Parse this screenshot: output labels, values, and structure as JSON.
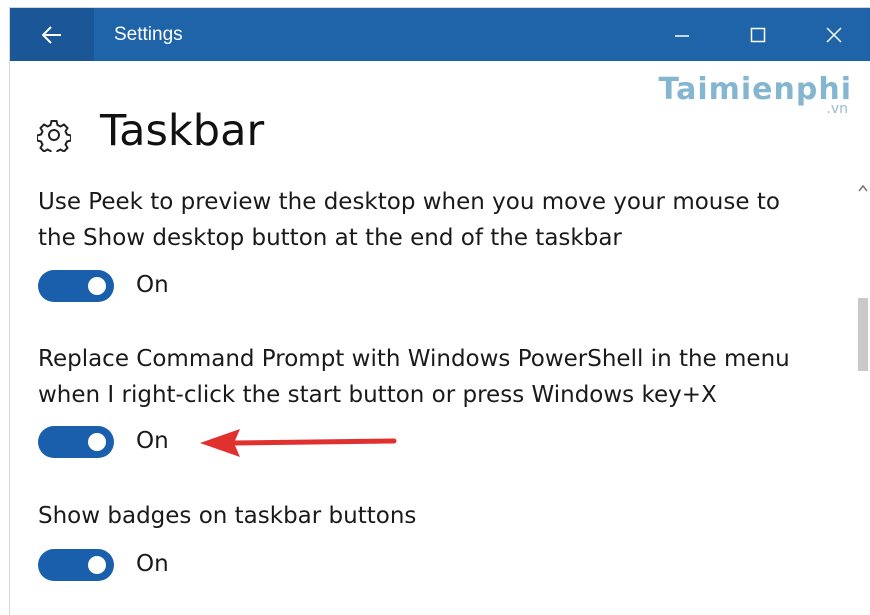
{
  "window": {
    "title": "Settings",
    "accent_color": "#1f63a8",
    "buttons": [
      "back-arrow-icon",
      "minimize-icon",
      "maximize-icon",
      "close-icon"
    ]
  },
  "watermark": {
    "brand": "Taimienphi",
    "suffix": ".vn"
  },
  "page": {
    "icon": "gear-icon",
    "title": "Taskbar"
  },
  "settings": [
    {
      "line1": "Use Peek to preview the desktop when you move your mouse to",
      "line2": "the Show desktop button at the end of the taskbar",
      "state": "On"
    },
    {
      "line1": "Replace Command Prompt with Windows PowerShell in the menu",
      "line2": "when I right-click the start button or press Windows key+X",
      "state": "On"
    },
    {
      "line1": "Show badges on taskbar buttons",
      "state": "On"
    }
  ],
  "toggle_color": "#1a5fac",
  "annotation_color": "#e0312f"
}
